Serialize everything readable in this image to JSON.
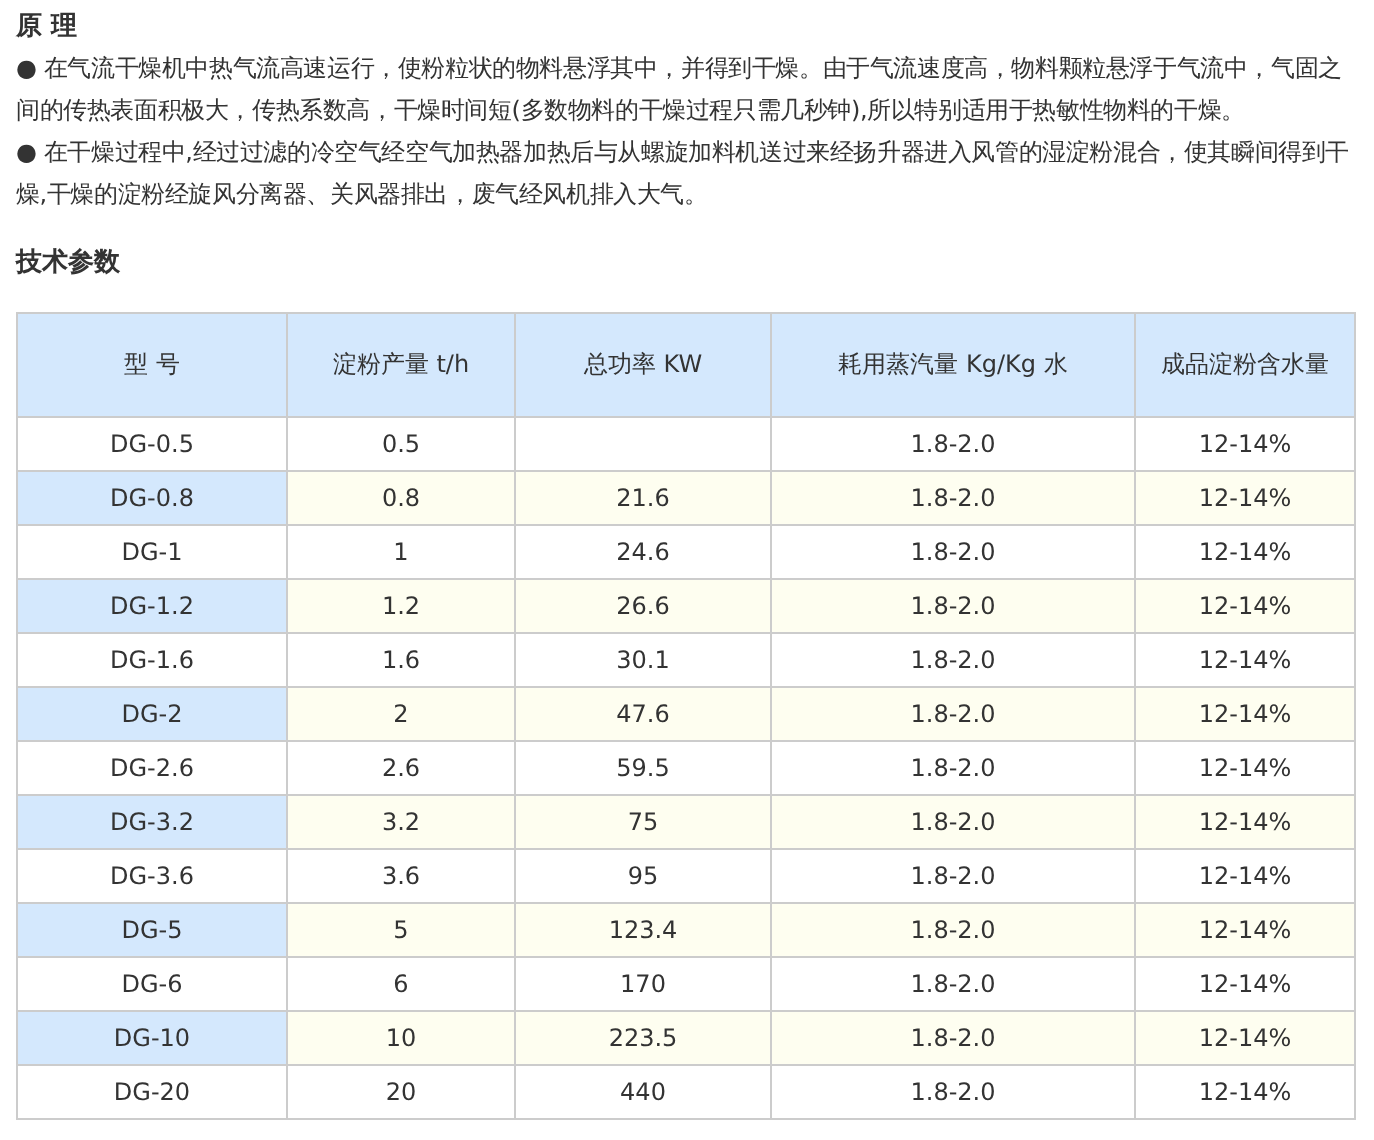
{
  "principle": {
    "title": "原 理",
    "paragraphs": [
      "● 在气流干燥机中热气流高速运行，使粉粒状的物料悬浮其中，并得到干燥。由于气流速度高，物料颗粒悬浮于气流中，气固之间的传热表面积极大，传热系数高，干燥时间短(多数物料的干燥过程只需几秒钟),所以特别适用于热敏性物料的干燥。",
      "● 在干燥过程中,经过过滤的冷空气经空气加热器加热后与从螺旋加料机送过来经扬升器进入风管的湿淀粉混合，使其瞬间得到干燥,干燥的淀粉经旋风分离器、关风器排出，废气经风机排入大气。"
    ]
  },
  "specs": {
    "title": "技术参数",
    "table": {
      "columns": [
        "型 号",
        "淀粉产量 t/h",
        "总功率 KW",
        "耗用蒸汽量 Kg/Kg 水",
        "成品淀粉含水量"
      ],
      "rows": [
        {
          "shaded": false,
          "cells": [
            "DG-0.5",
            "0.5",
            "",
            "1.8-2.0",
            "12-14%"
          ]
        },
        {
          "shaded": true,
          "cells": [
            "DG-0.8",
            "0.8",
            "21.6",
            "1.8-2.0",
            "12-14%"
          ]
        },
        {
          "shaded": false,
          "cells": [
            "DG-1",
            "1",
            "24.6",
            "1.8-2.0",
            "12-14%"
          ]
        },
        {
          "shaded": true,
          "cells": [
            "DG-1.2",
            "1.2",
            "26.6",
            "1.8-2.0",
            "12-14%"
          ]
        },
        {
          "shaded": false,
          "cells": [
            "DG-1.6",
            "1.6",
            "30.1",
            "1.8-2.0",
            "12-14%"
          ]
        },
        {
          "shaded": true,
          "cells": [
            "DG-2",
            "2",
            "47.6",
            "1.8-2.0",
            "12-14%"
          ]
        },
        {
          "shaded": false,
          "cells": [
            "DG-2.6",
            "2.6",
            "59.5",
            "1.8-2.0",
            "12-14%"
          ]
        },
        {
          "shaded": true,
          "cells": [
            "DG-3.2",
            "3.2",
            "75",
            "1.8-2.0",
            "12-14%"
          ]
        },
        {
          "shaded": false,
          "cells": [
            "DG-3.6",
            "3.6",
            "95",
            "1.8-2.0",
            "12-14%"
          ]
        },
        {
          "shaded": true,
          "cells": [
            "DG-5",
            "5",
            "123.4",
            "1.8-2.0",
            "12-14%"
          ]
        },
        {
          "shaded": false,
          "cells": [
            "DG-6",
            "6",
            "170",
            "1.8-2.0",
            "12-14%"
          ]
        },
        {
          "shaded": true,
          "cells": [
            "DG-10",
            "10",
            "223.5",
            "1.8-2.0",
            "12-14%"
          ]
        },
        {
          "shaded": false,
          "cells": [
            "DG-20",
            "20",
            "440",
            "1.8-2.0",
            "12-14%"
          ]
        }
      ]
    }
  }
}
